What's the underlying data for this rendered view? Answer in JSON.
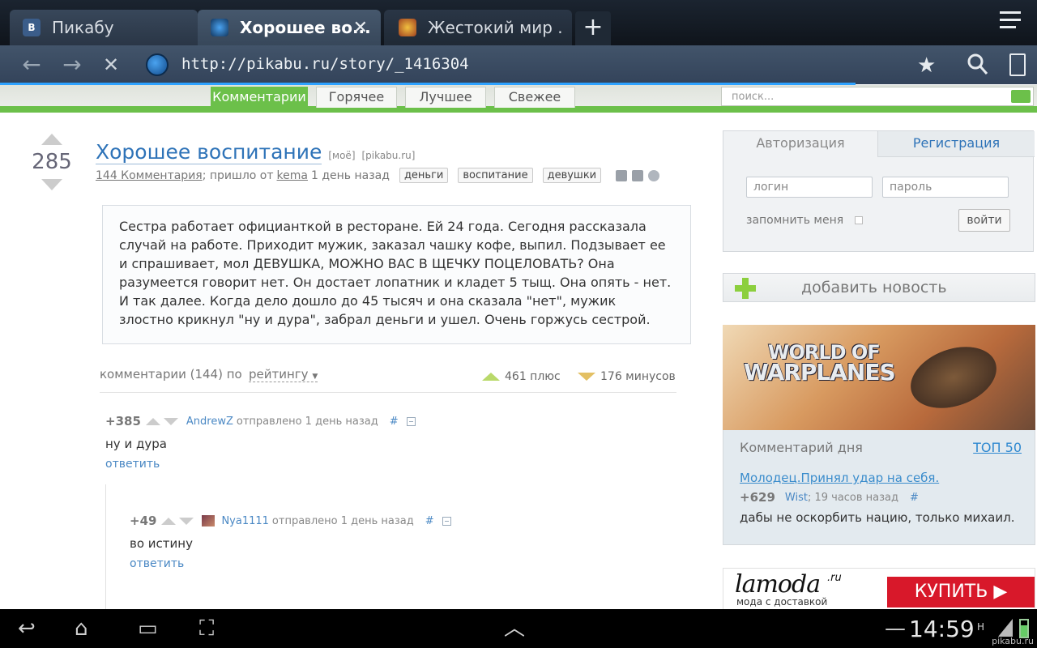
{
  "browser": {
    "tabs": [
      {
        "label": "Пикабу",
        "favicon": "vk-icon"
      },
      {
        "label": "Хорошее во...",
        "favicon": "globe-icon",
        "active": true
      },
      {
        "label": "Жестокий мир .",
        "favicon": "game-icon"
      }
    ],
    "new_tab": "+",
    "url": "http://pikabu.ru/story/_1416304"
  },
  "site": {
    "nav_tabs": [
      "Комментарии",
      "Горячее",
      "Лучшее",
      "Свежее"
    ],
    "search_placeholder": "поиск..."
  },
  "story": {
    "rating": "285",
    "title": "Хорошее воспитание",
    "tag_mine": "[моё]",
    "tag_source": "[pikabu.ru]",
    "comments_link": "144 Комментария",
    "posted_from": "; пришло от",
    "author": "kema",
    "posted_ago": "1 день назад",
    "tags": [
      "деньги",
      "воспитание",
      "девушки"
    ],
    "text": "Сестра работает официанткой в ресторане. Ей 24 года. Сегодня рассказала случай на работе. Приходит мужик, заказал чашку кофе, выпил. Подзывает ее и спрашивает, мол ДЕВУШКА, МОЖНО ВАС В ЩЕЧКУ ПОЦЕЛОВАТЬ? Она разумеется говорит нет. Он достает лопатник и кладет 5 тыщ. Она опять - нет. И так далее. Когда дело дошло до 45 тысяч и она сказала \"нет\", мужик злостно крикнул \"ну и дура\", забрал деньги и ушел. Очень горжусь сестрой."
  },
  "comments_header": {
    "label": "комментарии (144) по",
    "sort": "рейтингу",
    "plus": "461 плюс",
    "minus": "176 минусов"
  },
  "comments": [
    {
      "score": "+385",
      "user": "AndrewZ",
      "meta": "отправлено 1 день назад",
      "hash": "#",
      "text": "ну и дура",
      "reply": "ответить"
    },
    {
      "score": "+49",
      "user": "Nya1111",
      "meta": "отправлено 1 день назад",
      "hash": "#",
      "text": "во истину",
      "reply": "ответить"
    }
  ],
  "sidebar": {
    "auth_tab": "Авторизация",
    "register_tab": "Регистрация",
    "login_placeholder": "логин",
    "password_placeholder": "пароль",
    "remember": "запомнить меня",
    "login_button": "войти",
    "add_news": "добавить новость",
    "banner_line1": "WORLD OF",
    "banner_line2": "WARPLANES",
    "cod_title": "Комментарий дня",
    "cod_top": "ТОП 50",
    "cod_link": "Молодец.Принял удар на себя.",
    "cod_score": "+629",
    "cod_user": "Wist",
    "cod_ago": "; 19 часов назад",
    "cod_hash": "#",
    "cod_text": "дабы не оскорбить нацию, только михаил.",
    "lamoda_brand": "lamoda",
    "lamoda_ru": ".ru",
    "lamoda_slogan": "мода с доставкой",
    "lamoda_buy": "КУПИТЬ ▶"
  },
  "system": {
    "clock": "14:59",
    "watermark": "pikabu.ru"
  },
  "colors": {
    "green": "#6cc04a",
    "link_blue": "#2e73b8",
    "tabbar_dark": "#1b2430"
  }
}
